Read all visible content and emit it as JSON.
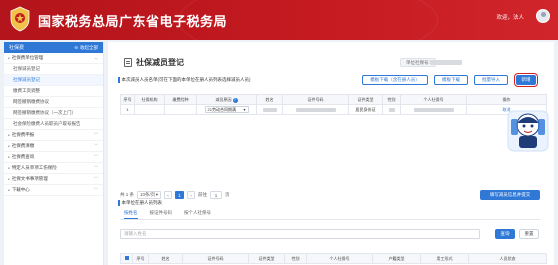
{
  "header": {
    "title": "国家税务总局广东省电子税务局",
    "welcome": "欢迎，法人"
  },
  "sidebar": {
    "title": "社保费",
    "collapse_label": "收起全部",
    "items": [
      {
        "label": "社保费单位管理",
        "type": "parent"
      },
      {
        "label": "社保减员登记",
        "type": "sub"
      },
      {
        "label": "社保减员登记",
        "type": "sub",
        "active": true
      },
      {
        "label": "缴费工资调整",
        "type": "sub"
      },
      {
        "label": "网签撤销缴费协议",
        "type": "sub"
      },
      {
        "label": "网签撤销缴费协议（一次上门）",
        "type": "sub"
      },
      {
        "label": "社会保险缴费人员职员户取号报告",
        "type": "sub"
      },
      {
        "label": "社保费申报",
        "type": "parent"
      },
      {
        "label": "社保费清缴",
        "type": "parent"
      },
      {
        "label": "社保费查询",
        "type": "parent"
      },
      {
        "label": "特定人员单项工伤保险",
        "type": "parent"
      },
      {
        "label": "社保文书事项管理",
        "type": "parent"
      },
      {
        "label": "下载中心",
        "type": "parent"
      }
    ]
  },
  "main": {
    "title": "社保减员登记",
    "org_label": "单位社保号:",
    "section1_label": "本次减员人员名单(可在下面的本单位在册人员列表选择减员人员)",
    "buttons": {
      "template_download": "模板下载（含在册人员）",
      "template_download2": "模板下载",
      "batch_import": "批量导入",
      "add": "新增"
    },
    "table1": {
      "headers": [
        "序号",
        "社保机构",
        "缴费险种",
        "减员原因",
        "姓名",
        "证件号码",
        "证件类型",
        "性别",
        "个人社保号",
        "操作"
      ],
      "rows": [
        {
          "index": "1",
          "reason": "21劳动合同期满",
          "id_type": "居民身份证",
          "action": "取消"
        }
      ]
    },
    "pager": {
      "total": "共 1 条",
      "page_size": "10条/页",
      "current": "1",
      "goto_prefix": "前往",
      "goto_value": "1",
      "goto_suffix": "页"
    },
    "confirm_button": "填写减员信息并提交",
    "section2_label": "本单位在册人员列表",
    "tabs": [
      "按姓名",
      "按证件号码",
      "按个人社保号"
    ],
    "search_placeholder": "请输入姓名",
    "search_button": "查询",
    "reset_button": "重置",
    "table2_headers": [
      "",
      "序号",
      "姓名",
      "证件号码",
      "证件类型",
      "性别",
      "个人社保号",
      "户籍类型",
      "用工形式",
      "人员状态"
    ]
  },
  "colors": {
    "brand_red": "#c41a20",
    "accent_blue": "#2f78d6",
    "highlight_red": "#d8201e"
  }
}
